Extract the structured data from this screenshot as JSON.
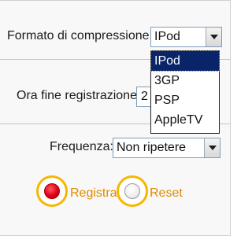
{
  "form": {
    "compression": {
      "label": "Formato di compressione:",
      "value": "IPod",
      "options": [
        "IPod",
        "3GP",
        "PSP",
        "AppleTV"
      ],
      "selected_index": 0
    },
    "end_time": {
      "label": "Ora fine registrazione:",
      "value": "2"
    },
    "frequency": {
      "label": "Frequenza:",
      "value": "Non ripetere"
    },
    "record_button": {
      "label": "Registra"
    },
    "reset_button": {
      "label": "Reset"
    }
  },
  "colors": {
    "accent": "#f5b700",
    "record_dot": "#e0001a",
    "button_text": "#e08b00",
    "selected_option_bg": "#0a246a"
  }
}
